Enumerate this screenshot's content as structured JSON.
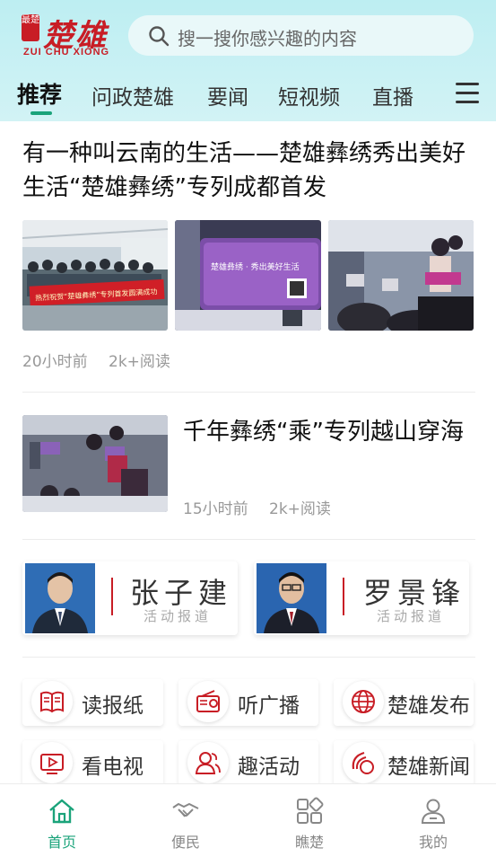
{
  "header": {
    "brand_text": "楚雄",
    "brand_seal": "最楚",
    "brand_sub": "ZUI CHU XIONG",
    "search_placeholder": "搜一搜你感兴趣的内容"
  },
  "tabs": [
    {
      "label": "推荐",
      "active": true
    },
    {
      "label": "问政楚雄",
      "active": false
    },
    {
      "label": "要闻",
      "active": false
    },
    {
      "label": "短视频",
      "active": false
    },
    {
      "label": "直播",
      "active": false
    }
  ],
  "articles": [
    {
      "title": "有一种叫云南的生活——楚雄彝绣秀出美好生活“楚雄彝绣”专列成都首发",
      "time": "20小时前",
      "reads": "2k+阅读",
      "image1_banner": "热烈祝贺“楚雄彝绣”专列首发圆满成功",
      "image2_caption": "楚雄彝绣 · 秀出美好生活"
    },
    {
      "title": "千年彝绣“乘”专列越山穿海",
      "time": "15小时前",
      "reads": "2k+阅读"
    }
  ],
  "people": [
    {
      "name": "张子建",
      "sub": "活动报道"
    },
    {
      "name": "罗景锋",
      "sub": "活动报道"
    }
  ],
  "services": [
    {
      "label": "读报纸",
      "icon": "newspaper-icon"
    },
    {
      "label": "听广播",
      "icon": "radio-icon"
    },
    {
      "label": "楚雄发布",
      "icon": "globe-icon"
    },
    {
      "label": "看电视",
      "icon": "tv-icon"
    },
    {
      "label": "趣活动",
      "icon": "people-icon"
    },
    {
      "label": "楚雄新闻",
      "icon": "news-swirl-icon"
    }
  ],
  "bottom_nav": [
    {
      "label": "首页",
      "icon": "home-icon",
      "active": true
    },
    {
      "label": "便民",
      "icon": "handshake-icon",
      "active": false
    },
    {
      "label": "瞧楚",
      "icon": "grid-icon",
      "active": false
    },
    {
      "label": "我的",
      "icon": "user-icon",
      "active": false
    }
  ],
  "colors": {
    "accent": "#1aa37a",
    "brand_red": "#c81d25",
    "header_bg": "#bdeef2"
  }
}
